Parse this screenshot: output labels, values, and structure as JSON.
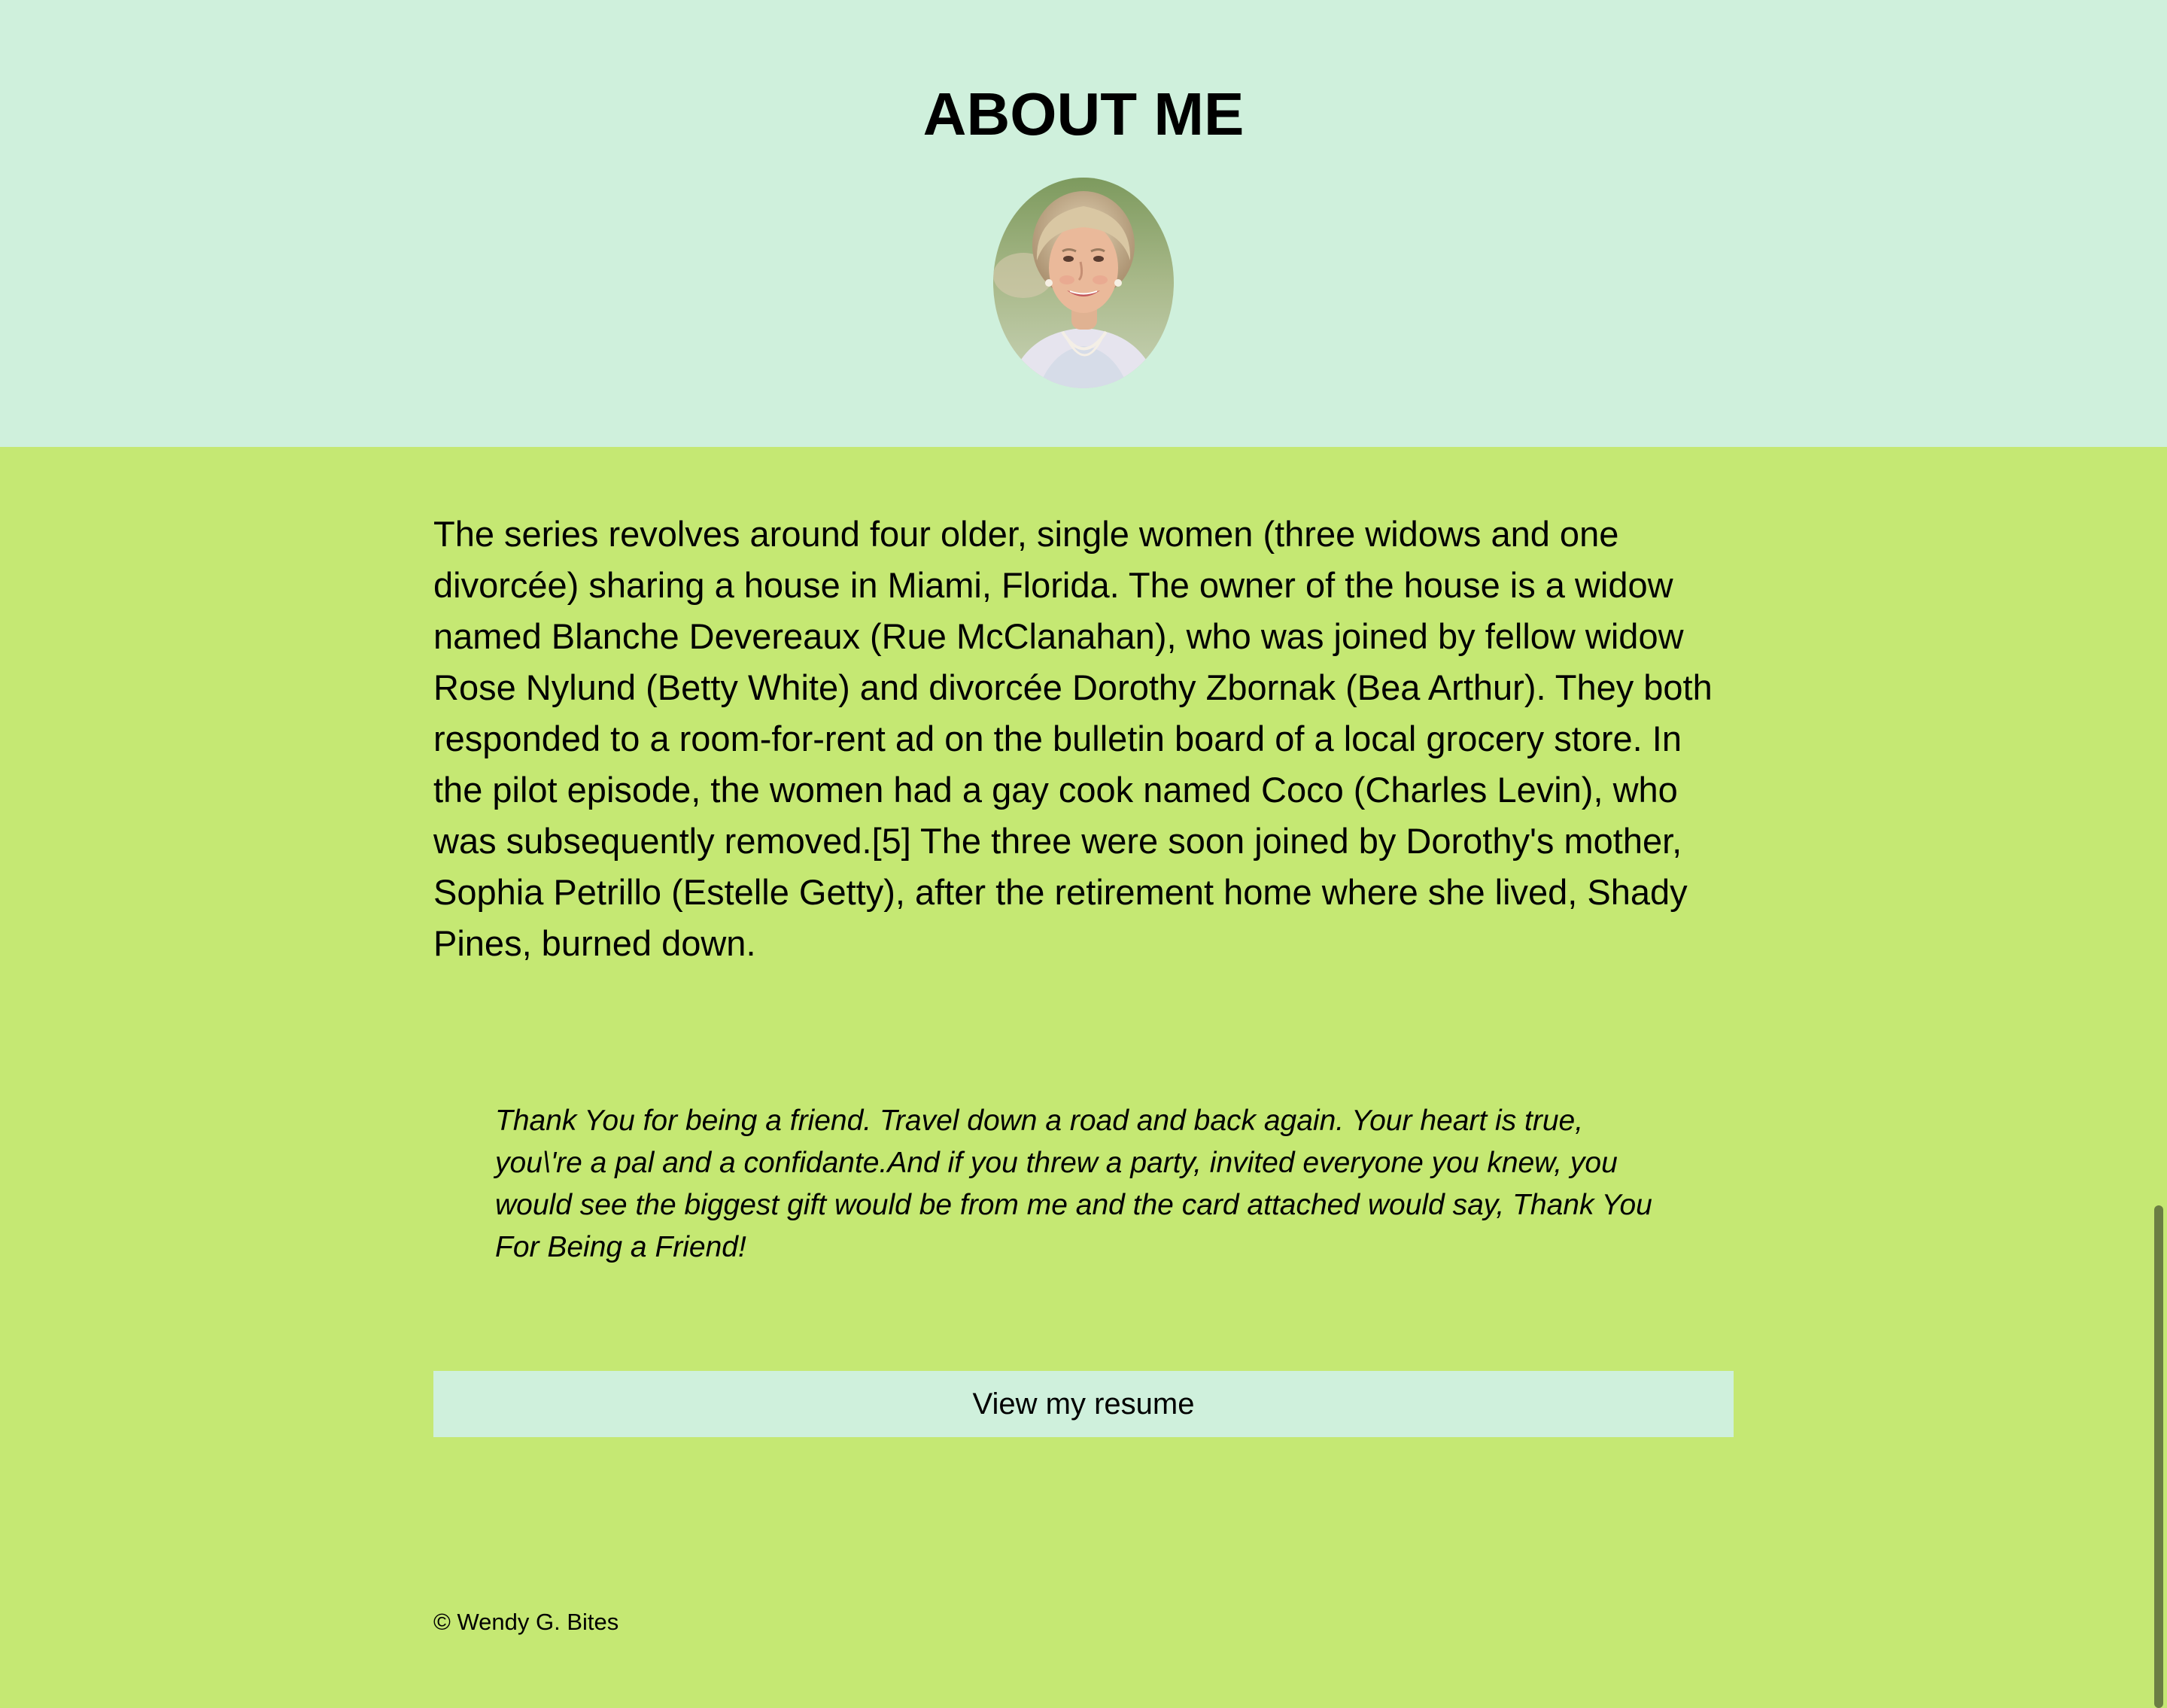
{
  "header": {
    "title": "ABOUT ME",
    "avatar_icon": "profile-photo-portrait",
    "bg_color": "#cff0dc"
  },
  "main": {
    "bg_color": "#c5e873",
    "bio": "The series revolves around four older, single women (three widows and one divorcée) sharing a house in Miami, Florida. The owner of the house is a widow named Blanche Devereaux (Rue McClanahan), who was joined by fellow widow Rose Nylund (Betty White) and divorcée Dorothy Zbornak (Bea Arthur). They both responded to a room-for-rent ad on the bulletin board of a local grocery store. In the pilot episode, the women had a gay cook named Coco (Charles Levin), who was subsequently removed.[5] The three were soon joined by Dorothy's mother, Sophia Petrillo (Estelle Getty), after the retirement home where she lived, Shady Pines, burned down.",
    "quote": "Thank You for being a friend. Travel down a road and back again. Your heart is true, you\\'re a pal and a confidante.And if you threw a party, invited everyone you knew, you would see the biggest gift would be from me and the card attached would say, Thank You For Being a Friend!",
    "resume_button_label": "View my resume"
  },
  "footer": {
    "copyright": "© Wendy G. Bites"
  }
}
